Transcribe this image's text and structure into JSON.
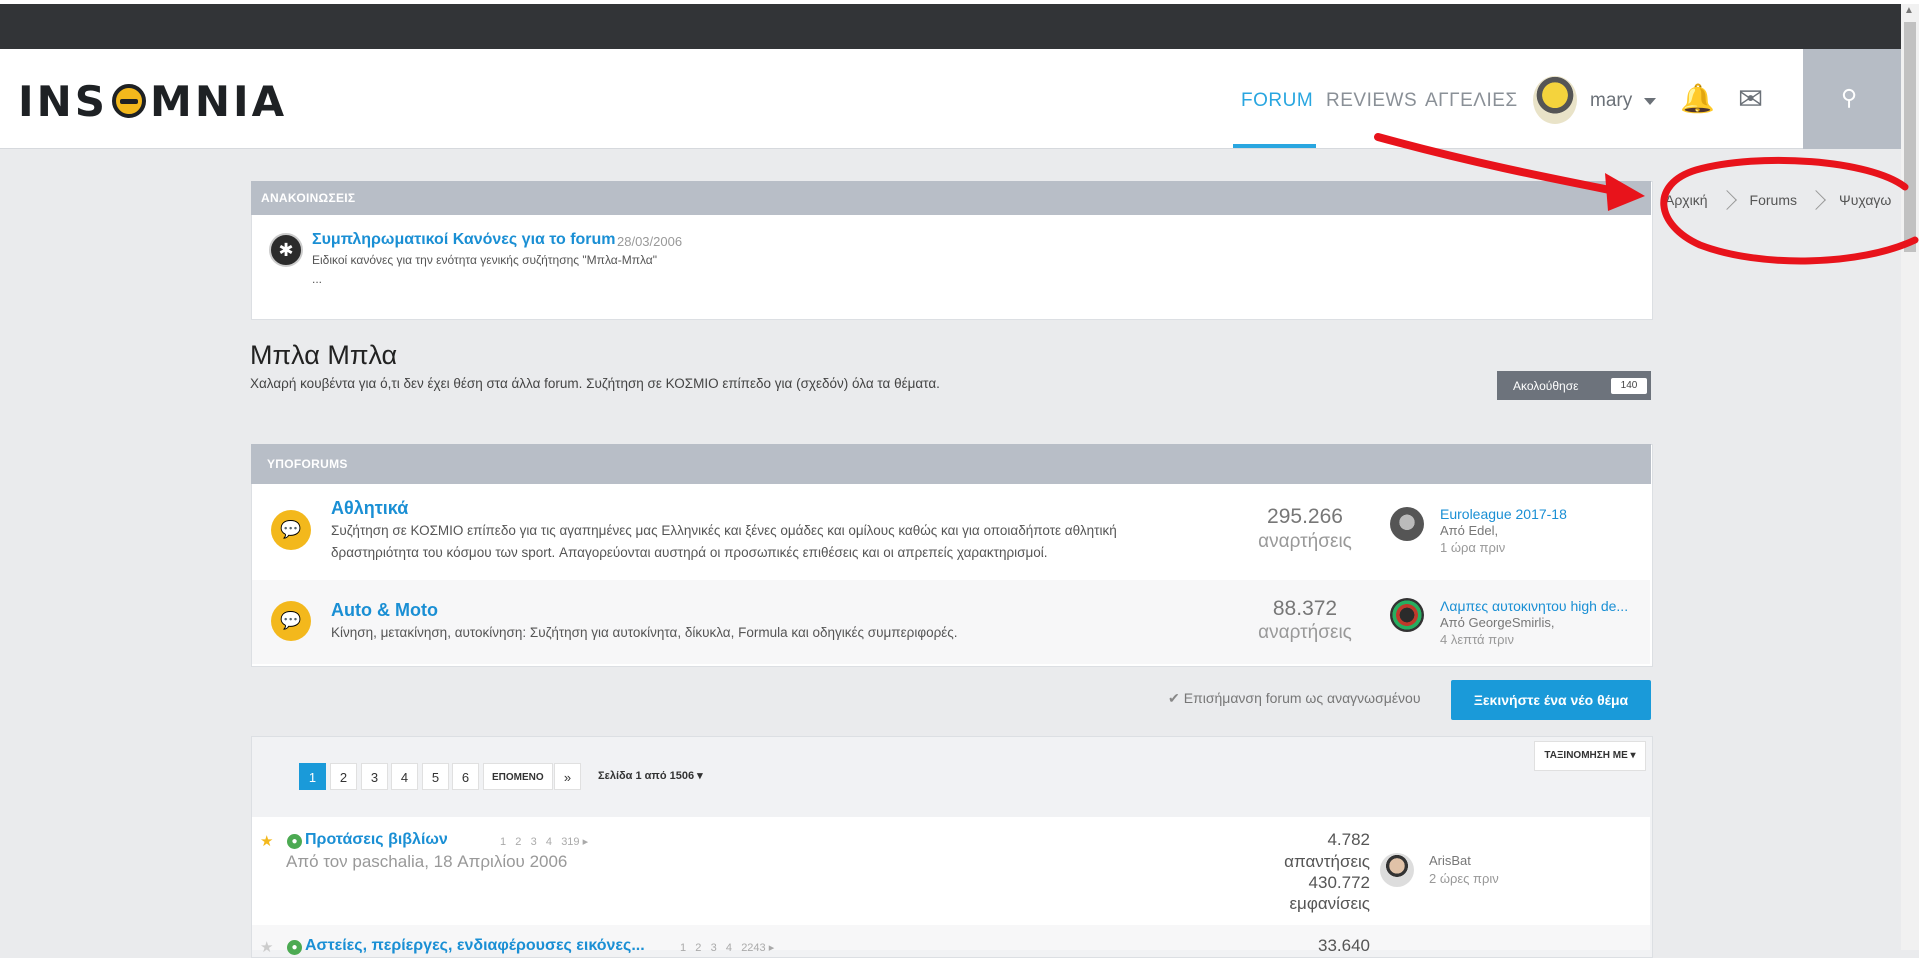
{
  "header": {
    "nav": [
      {
        "label": "FORUM",
        "active": true
      },
      {
        "label": "REVIEWS",
        "active": false
      },
      {
        "label": "ΑΓΓΕΛΙΕΣ",
        "active": false
      }
    ],
    "username": "mary",
    "icons": [
      "bell-icon",
      "mail-icon",
      "search-icon"
    ],
    "accent_color": "#29a6e0"
  },
  "breadcrumb": [
    "Αρχική",
    "Forums",
    "Ψυχαγω"
  ],
  "announcements": {
    "heading": "ΑΝΑΚΟΙΝΩΣΕΙΣ",
    "title": "Συμπληρωματικοί Κανόνες για το forum",
    "date": "28/03/2006",
    "body": "Ειδικοί κανόνες για την ενότητα γενικής συζήτησης \"Μπλα-Μπλα\"",
    "more": "..."
  },
  "forum": {
    "title": "Μπλα Μπλα",
    "description": "Χαλαρή κουβέντα για ό,τι δεν έχει θέση στα άλλα forum. Συζήτηση σε ΚΟΣΜΙΟ επίπεδο για (σχεδόν) όλα τα θέματα.",
    "follow_label": "Ακολούθησε",
    "follow_count": "140"
  },
  "subforums": {
    "heading": "ΥΠΟFORUMS",
    "items": [
      {
        "name": "Αθλητικά",
        "description": "Συζήτηση σε ΚΟΣΜΙΟ επίπεδο για τις αγαπημένες μας Ελληνικές και ξένες ομάδες και ομίλους καθώς και για οποιαδήποτε αθλητική δραστηριότητα του κόσμου των sport. Απαγορεύονται αυστηρά οι προσωπικές επιθέσεις και οι απρεπείς χαρακτηρισμοί.",
        "posts": "295.266",
        "posts_label": "αναρτήσεις",
        "last_title": "Euroleague 2017-18",
        "last_by": "Από Edel,",
        "last_time": "1 ώρα πριν"
      },
      {
        "name": "Auto & Moto",
        "description": "Κίνηση, μετακίνηση, αυτοκίνηση: Συζήτηση για αυτοκίνητα, δίκυκλα, Formula και οδηγικές συμπεριφορές.",
        "posts": "88.372",
        "posts_label": "αναρτήσεις",
        "last_title": "Λαμπες αυτοκινητου high de...",
        "last_by": "Από GeorgeSmirlis,",
        "last_time": "4 λεπτά πριν"
      }
    ]
  },
  "actions": {
    "mark_read": "Επισήμανση forum ως αναγνωσμένου",
    "new_topic": "Ξεκινήστε ένα νέο θέμα"
  },
  "pagination": {
    "pages": [
      "1",
      "2",
      "3",
      "4",
      "5",
      "6"
    ],
    "current": "1",
    "next_label": "ΕΠΟΜΕΝΟ",
    "last_label": "»",
    "page_info": "Σελίδα 1 από 1506",
    "sort_label": "ΤΑΞΙΝΟΜΗΣΗ ΜΕ"
  },
  "topics": [
    {
      "title": "Προτάσεις βιβλίων",
      "meta": "Από τον paschalia, 18 Απριλίου 2006",
      "pages": [
        "1",
        "2",
        "3",
        "4",
        "319"
      ],
      "replies": "4.782",
      "replies_label": "απαντήσεις",
      "views": "430.772",
      "views_label": "εμφανίσεις",
      "last_user": "ArisBat",
      "last_time": "2 ώρες πριν"
    },
    {
      "title": "Αστείες, περίεργες, ενδιαφέρουσες εικόνες...",
      "pages": [
        "1",
        "2",
        "3",
        "4",
        "2243"
      ],
      "replies": "33.640"
    }
  ]
}
